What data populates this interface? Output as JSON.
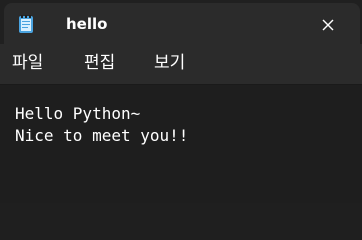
{
  "tab": {
    "title": "hello",
    "icon": "notepad-icon",
    "close_icon": "close-icon"
  },
  "menu": {
    "items": [
      "파일",
      "편집",
      "보기"
    ]
  },
  "editor": {
    "lines": [
      "Hello Python~",
      "Nice to meet you!!"
    ]
  },
  "colors": {
    "titlebar": "#202020",
    "tab": "#2b2b2b",
    "menubar": "#2b2b2b",
    "editor": "#1e1e1e",
    "text": "#ffffff",
    "icon_accent": "#4aa3df"
  }
}
